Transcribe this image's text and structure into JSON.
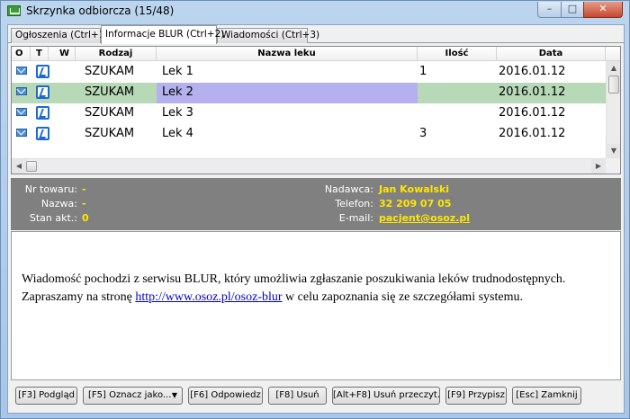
{
  "window": {
    "title": "Skrzynka odbiorcza (15/48)",
    "min": "–",
    "max": "□",
    "close": "✕"
  },
  "tabs": [
    "Ogłoszenia (Ctrl+1)",
    "Informacje BLUR (Ctrl+2)",
    "Wiadomości (Ctrl+3)"
  ],
  "grid": {
    "headers": [
      "O",
      "T",
      "W",
      "Rodzaj",
      "Nazwa leku",
      "Ilość",
      "Data"
    ],
    "rows": [
      {
        "rodzaj": "SZUKAM",
        "nazwa": "Lek 1",
        "ilosc": "1",
        "data": "2016.01.12"
      },
      {
        "rodzaj": "SZUKAM",
        "nazwa": "Lek 2",
        "ilosc": "",
        "data": "2016.01.12"
      },
      {
        "rodzaj": "SZUKAM",
        "nazwa": "Lek 3",
        "ilosc": "",
        "data": "2016.01.12"
      },
      {
        "rodzaj": "SZUKAM",
        "nazwa": "Lek 4",
        "ilosc": "3",
        "data": "2016.01.12"
      }
    ],
    "selected_row": 2,
    "row_highlight_color": "#b7d9b7",
    "cell_highlight_color": "#b5b1ee"
  },
  "details": {
    "nr_towaru": {
      "label": "Nr towaru:",
      "value": "-"
    },
    "nazwa": {
      "label": "Nazwa:",
      "value": "-"
    },
    "stan": {
      "label": "Stan akt.:",
      "value": "0"
    },
    "nadawca": {
      "label": "Nadawca:",
      "value": "Jan Kowalski"
    },
    "telefon": {
      "label": "Telefon:",
      "value": "32 209 07 05"
    },
    "email": {
      "label": "E-mail:",
      "value": "pacjent@osoz.pl"
    }
  },
  "message": {
    "line1": "Wiadomość pochodzi z serwisu BLUR, który umożliwia zgłaszanie poszukiwania leków trudnodostępnych.",
    "line2_pre": "Zapraszamy na stronę ",
    "link": "http://www.osoz.pl/osoz-blur",
    "line2_post": " w celu zapoznania się ze szczegółami systemu."
  },
  "buttons": [
    "[F3] Podgląd",
    "[F5] Oznacz jako...",
    "[F6] Odpowiedz",
    "[F8] Usuń",
    "[Alt+F8] Usuń przeczyt.",
    "[F9] Przypisz",
    "[Esc] Zamknij"
  ]
}
